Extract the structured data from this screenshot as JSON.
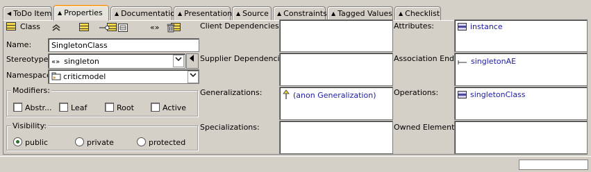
{
  "tabs": [
    {
      "label": "ToDo Item",
      "icon": "triangle-left",
      "active": false
    },
    {
      "label": "Properties",
      "icon": "triangle-up",
      "active": true
    },
    {
      "label": "Documentation",
      "icon": "triangle-up",
      "active": false
    },
    {
      "label": "Presentation",
      "icon": "triangle-up",
      "active": false
    },
    {
      "label": "Source",
      "icon": "triangle-up",
      "active": false
    },
    {
      "label": "Constraints",
      "icon": "triangle-up",
      "active": false
    },
    {
      "label": "Tagged Values",
      "icon": "triangle-up",
      "active": false
    },
    {
      "label": "Checklist",
      "icon": "triangle-up",
      "active": false
    }
  ],
  "header": {
    "element_type": "Class"
  },
  "toolbar": {
    "icons": [
      "navigate-up-icon",
      "new-attribute-icon",
      "new-operation-icon",
      "new-reception-icon",
      "new-inner-class-icon",
      "new-class-icon",
      "new-stereotype-icon",
      "delete-icon"
    ],
    "stereotype_glyph": "«»"
  },
  "form": {
    "name_label": "Name:",
    "name_value": "SingletonClass",
    "stereotype_label": "Stereotype:",
    "stereotype_glyph": "«»",
    "stereotype_value": "singleton",
    "namespace_label": "Namespace:",
    "namespace_value": "criticmodel"
  },
  "modifiers": {
    "title": "Modifiers:",
    "items": [
      {
        "label": "Abstr...",
        "checked": false
      },
      {
        "label": "Leaf",
        "checked": false
      },
      {
        "label": "Root",
        "checked": false
      },
      {
        "label": "Active",
        "checked": false
      }
    ]
  },
  "visibility": {
    "title": "Visibility:",
    "options": [
      {
        "label": "public",
        "selected": true
      },
      {
        "label": "private",
        "selected": false
      },
      {
        "label": "protected",
        "selected": false
      }
    ]
  },
  "middle": {
    "client_dependencies_label": "Client Dependencies:",
    "supplier_dependencies_label": "Supplier Dependencies:",
    "generalizations_label": "Generalizations:",
    "generalizations_items": [
      "(anon Generalization)"
    ],
    "specializations_label": "Specializations:"
  },
  "right": {
    "attributes_label": "Attributes:",
    "attributes_items": [
      "instance"
    ],
    "association_ends_label": "Association Ends:",
    "association_ends_items": [
      "singletonAE"
    ],
    "operations_label": "Operations:",
    "operations_items": [
      "singletonClass"
    ],
    "owned_elements_label": "Owned Elements:"
  },
  "colors": {
    "active_tab_accent": "#f7a43c",
    "link": "#1a1aa8",
    "background": "#d4d0c8"
  }
}
